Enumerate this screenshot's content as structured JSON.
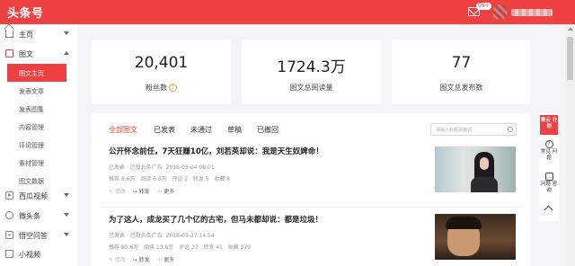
{
  "header": {
    "logo": "头条号",
    "mail_badge": "99+"
  },
  "sidebar": {
    "items": [
      {
        "label": "主页",
        "icon": "home-icon",
        "expanded": false
      },
      {
        "label": "图文",
        "icon": "document-icon",
        "expanded": true
      },
      {
        "label": "西瓜视频",
        "icon": "play-icon",
        "expanded": false
      },
      {
        "label": "微头条",
        "icon": "globe-icon",
        "expanded": false
      },
      {
        "label": "悟空问答",
        "icon": "qa-icon",
        "expanded": false
      },
      {
        "label": "小视频",
        "icon": "video-icon",
        "expanded": false
      }
    ],
    "subitems": [
      "图文主页",
      "发表文章",
      "发表图集",
      "内容管理",
      "评论管理",
      "素材管理",
      "图文数据"
    ],
    "active_subitem": "图文主页"
  },
  "stats": [
    {
      "value": "20,401",
      "label": "粉丝数"
    },
    {
      "value": "1724.3万",
      "label": "图文总阅读量"
    },
    {
      "value": "77",
      "label": "图文总发布数"
    }
  ],
  "tabs": [
    "全部图文",
    "已发表",
    "未通过",
    "草稿",
    "已撤回"
  ],
  "active_tab": "全部图文",
  "search": {
    "placeholder": "请输入标题关键词"
  },
  "articles": [
    {
      "title": "公开怀念前任，7天狂赚10亿，刘若英却说：我是天生奴婢命！",
      "status": "已发表",
      "channel": "已投头条广告",
      "time": "2018-05-04 08:01",
      "recommend": "推荐 8.6万",
      "reads": "阅读 6.0万",
      "comments": "评论 2",
      "shares": "转发 5",
      "favorites": "收藏 8",
      "actions": [
        "修改",
        "转发",
        "更多"
      ]
    },
    {
      "title": "为了这人，成龙买了几个亿的古宅，但马未都却说：都是垃圾！",
      "status": "已发表",
      "channel": "已投头条广告",
      "time": "2018-03-27 14:54",
      "recommend": "推荐 85.6万",
      "reads": "阅读 13.6万",
      "comments": "评论 37",
      "shares": "转发 41",
      "favorites": "收藏 379",
      "actions": [
        "修改",
        "转发",
        "更多"
      ]
    }
  ],
  "float": {
    "promo": "青云 计划",
    "items": [
      {
        "label": "常见 问题",
        "icon": "question-icon"
      },
      {
        "label": "问题 咨询",
        "icon": "chat-icon"
      }
    ]
  },
  "colors": {
    "brand": "#f04142"
  }
}
